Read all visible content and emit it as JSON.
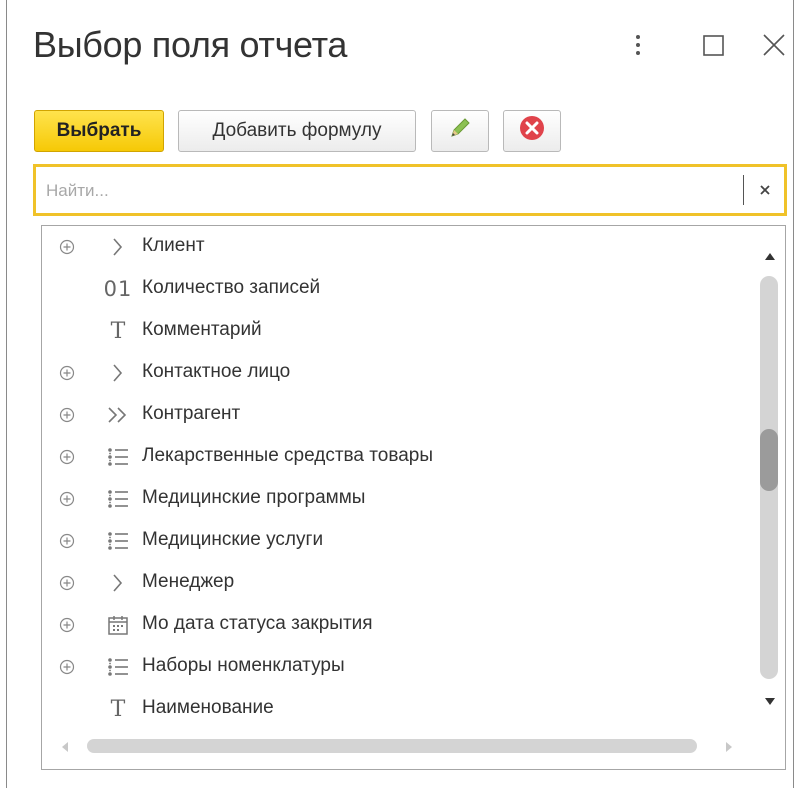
{
  "window": {
    "title": "Выбор поля отчета",
    "more_icon": "more-vertical-icon",
    "maximize_icon": "maximize-icon",
    "close_icon": "close-icon"
  },
  "toolbar": {
    "select_label": "Выбрать",
    "add_formula_label": "Добавить формулу",
    "edit_icon": "pencil-icon",
    "delete_icon": "delete-circle-icon"
  },
  "search": {
    "placeholder": "Найти...",
    "value": "",
    "clear_icon": "clear-icon"
  },
  "tree": {
    "items": [
      {
        "label": "Клиент",
        "expandable": true,
        "type_icon": "reference-icon"
      },
      {
        "label": "Количество записей",
        "expandable": false,
        "type_icon": "number-icon",
        "type_glyph": "01"
      },
      {
        "label": "Комментарий",
        "expandable": false,
        "type_icon": "text-icon",
        "type_glyph": "T"
      },
      {
        "label": "Контактное лицо",
        "expandable": true,
        "type_icon": "reference-icon"
      },
      {
        "label": "Контрагент",
        "expandable": true,
        "type_icon": "composite-reference-icon"
      },
      {
        "label": "Лекарственные средства товары",
        "expandable": true,
        "type_icon": "list-icon"
      },
      {
        "label": "Медицинские программы",
        "expandable": true,
        "type_icon": "list-icon"
      },
      {
        "label": "Медицинские услуги",
        "expandable": true,
        "type_icon": "list-icon"
      },
      {
        "label": "Менеджер",
        "expandable": true,
        "type_icon": "reference-icon"
      },
      {
        "label": "Мо дата статуса закрытия",
        "expandable": true,
        "type_icon": "calendar-icon"
      },
      {
        "label": "Наборы номенклатуры",
        "expandable": true,
        "type_icon": "list-icon"
      },
      {
        "label": "Наименование",
        "expandable": false,
        "type_icon": "text-icon",
        "type_glyph": "T"
      }
    ],
    "vertical_scroll_position": 0.45
  },
  "colors": {
    "accent_yellow": "#f6c906",
    "search_border": "#f0c229",
    "delete_red": "#e0434b",
    "edit_green": "#7bb03a"
  }
}
